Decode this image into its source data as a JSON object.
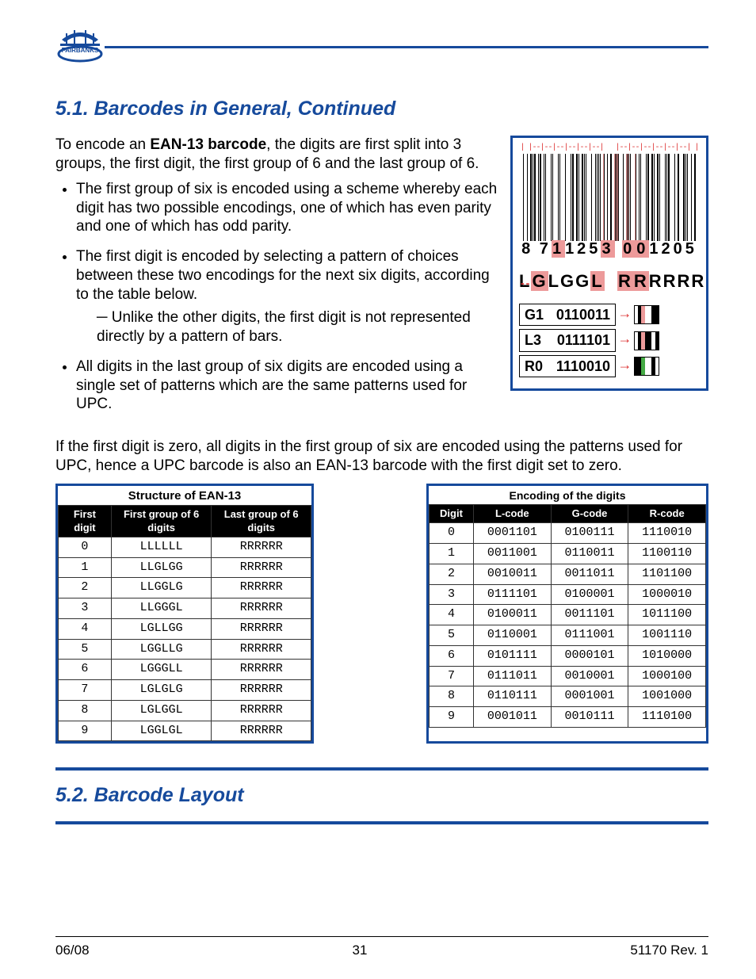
{
  "section_title": "5.1. Barcodes in General, Continued",
  "intro": {
    "p1a": "To encode an ",
    "p1b": "EAN-13 barcode",
    "p1c": ", the digits are first split into 3 groups, the first digit, the first group of 6 and the last group of 6."
  },
  "bullets": [
    "The first group of six is encoded using a scheme whereby each digit has two possible encodings, one of which has even parity and one of which has odd parity.",
    "The first digit is encoded by selecting a pattern of choices between these two encodings for the next six digits, according to the table below.",
    "All digits in the last group of six digits are encoded using a single set of patterns which are the same patterns used for UPC."
  ],
  "subbullet": "Unlike the other digits, the first digit is not represented directly by a pattern of bars.",
  "figure": {
    "digits_lead": "8",
    "digits_left": [
      "7",
      "1",
      "1",
      "2",
      "5",
      "3"
    ],
    "digits_right": [
      "0",
      "0",
      "1",
      "2",
      "0",
      "5"
    ],
    "highlight_left_idx": [
      1,
      5
    ],
    "highlight_right_idx": [
      0,
      1
    ],
    "parity_left": [
      "L",
      "G",
      "L",
      "G",
      "G",
      "L"
    ],
    "parity_right": [
      "R",
      "R",
      "R",
      "R",
      "R",
      "R"
    ],
    "parity_hl_left": [
      1,
      5
    ],
    "parity_hl_right": [
      0,
      1
    ],
    "enc": [
      {
        "label": "G1",
        "bits": "0110011"
      },
      {
        "label": "L3",
        "bits": "0111101"
      },
      {
        "label": "R0",
        "bits": "1110010"
      }
    ]
  },
  "after_para": "If the first digit is zero, all digits in the first group of six are encoded using the patterns used for UPC, hence a UPC barcode is also an EAN-13 barcode with the first digit set to zero.",
  "table1": {
    "caption": "Structure of EAN-13",
    "headers": [
      "First digit",
      "First group of 6 digits",
      "Last group of 6 digits"
    ],
    "rows": [
      [
        "0",
        "LLLLLL",
        "RRRRRR"
      ],
      [
        "1",
        "LLGLGG",
        "RRRRRR"
      ],
      [
        "2",
        "LLGGLG",
        "RRRRRR"
      ],
      [
        "3",
        "LLGGGL",
        "RRRRRR"
      ],
      [
        "4",
        "LGLLGG",
        "RRRRRR"
      ],
      [
        "5",
        "LGGLLG",
        "RRRRRR"
      ],
      [
        "6",
        "LGGGLL",
        "RRRRRR"
      ],
      [
        "7",
        "LGLGLG",
        "RRRRRR"
      ],
      [
        "8",
        "LGLGGL",
        "RRRRRR"
      ],
      [
        "9",
        "LGGLGL",
        "RRRRRR"
      ]
    ]
  },
  "table2": {
    "caption": "Encoding  of the digits",
    "headers": [
      "Digit",
      "L-code",
      "G-code",
      "R-code"
    ],
    "rows": [
      [
        "0",
        "0001101",
        "0100111",
        "1110010"
      ],
      [
        "1",
        "0011001",
        "0110011",
        "1100110"
      ],
      [
        "2",
        "0010011",
        "0011011",
        "1101100"
      ],
      [
        "3",
        "0111101",
        "0100001",
        "1000010"
      ],
      [
        "4",
        "0100011",
        "0011101",
        "1011100"
      ],
      [
        "5",
        "0110001",
        "0111001",
        "1001110"
      ],
      [
        "6",
        "0101111",
        "0000101",
        "1010000"
      ],
      [
        "7",
        "0111011",
        "0010001",
        "1000100"
      ],
      [
        "8",
        "0110111",
        "0001001",
        "1001000"
      ],
      [
        "9",
        "0001011",
        "0010111",
        "1110100"
      ]
    ]
  },
  "bottom_section_title": "5.2. Barcode Layout",
  "footer": {
    "left": "06/08",
    "center": "31",
    "right": "51170    Rev. 1"
  }
}
